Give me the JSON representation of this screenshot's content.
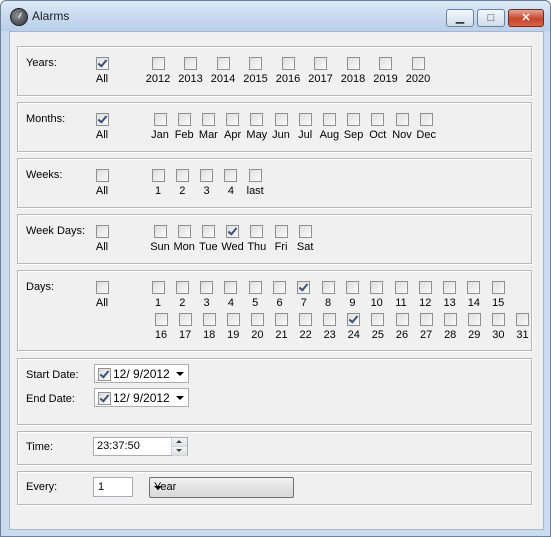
{
  "window": {
    "title": "Alarms",
    "minimize_label": "▁",
    "maximize_label": "□",
    "close_label": "✕"
  },
  "years": {
    "label": "Years:",
    "items": [
      {
        "label": "All",
        "checked": true
      },
      {
        "label": "2012",
        "checked": false
      },
      {
        "label": "2013",
        "checked": false
      },
      {
        "label": "2014",
        "checked": false
      },
      {
        "label": "2015",
        "checked": false
      },
      {
        "label": "2016",
        "checked": false
      },
      {
        "label": "2017",
        "checked": false
      },
      {
        "label": "2018",
        "checked": false
      },
      {
        "label": "2019",
        "checked": false
      },
      {
        "label": "2020",
        "checked": false
      }
    ]
  },
  "months": {
    "label": "Months:",
    "items": [
      {
        "label": "All",
        "checked": true
      },
      {
        "label": "Jan",
        "checked": false
      },
      {
        "label": "Feb",
        "checked": false
      },
      {
        "label": "Mar",
        "checked": false
      },
      {
        "label": "Apr",
        "checked": false
      },
      {
        "label": "May",
        "checked": false
      },
      {
        "label": "Jun",
        "checked": false
      },
      {
        "label": "Jul",
        "checked": false
      },
      {
        "label": "Aug",
        "checked": false
      },
      {
        "label": "Sep",
        "checked": false
      },
      {
        "label": "Oct",
        "checked": false
      },
      {
        "label": "Nov",
        "checked": false
      },
      {
        "label": "Dec",
        "checked": false
      }
    ]
  },
  "weeks": {
    "label": "Weeks:",
    "items": [
      {
        "label": "All",
        "checked": false
      },
      {
        "label": "1",
        "checked": false
      },
      {
        "label": "2",
        "checked": false
      },
      {
        "label": "3",
        "checked": false
      },
      {
        "label": "4",
        "checked": false
      },
      {
        "label": "last",
        "checked": false
      }
    ]
  },
  "weekdays": {
    "label": "Week Days:",
    "items": [
      {
        "label": "All",
        "checked": false
      },
      {
        "label": "Sun",
        "checked": false
      },
      {
        "label": "Mon",
        "checked": false
      },
      {
        "label": "Tue",
        "checked": false
      },
      {
        "label": "Wed",
        "checked": true
      },
      {
        "label": "Thu",
        "checked": false
      },
      {
        "label": "Fri",
        "checked": false
      },
      {
        "label": "Sat",
        "checked": false
      }
    ]
  },
  "days": {
    "label": "Days:",
    "all": {
      "label": "All",
      "checked": false
    },
    "row1": [
      {
        "label": "1",
        "checked": false
      },
      {
        "label": "2",
        "checked": false
      },
      {
        "label": "3",
        "checked": false
      },
      {
        "label": "4",
        "checked": false
      },
      {
        "label": "5",
        "checked": false
      },
      {
        "label": "6",
        "checked": false
      },
      {
        "label": "7",
        "checked": true
      },
      {
        "label": "8",
        "checked": false
      },
      {
        "label": "9",
        "checked": false
      },
      {
        "label": "10",
        "checked": false
      },
      {
        "label": "11",
        "checked": false
      },
      {
        "label": "12",
        "checked": false
      },
      {
        "label": "13",
        "checked": false
      },
      {
        "label": "14",
        "checked": false
      },
      {
        "label": "15",
        "checked": false
      }
    ],
    "row2": [
      {
        "label": "16",
        "checked": false
      },
      {
        "label": "17",
        "checked": false
      },
      {
        "label": "18",
        "checked": false
      },
      {
        "label": "19",
        "checked": false
      },
      {
        "label": "20",
        "checked": false
      },
      {
        "label": "21",
        "checked": false
      },
      {
        "label": "22",
        "checked": false
      },
      {
        "label": "23",
        "checked": false
      },
      {
        "label": "24",
        "checked": true
      },
      {
        "label": "25",
        "checked": false
      },
      {
        "label": "26",
        "checked": false
      },
      {
        "label": "27",
        "checked": false
      },
      {
        "label": "28",
        "checked": false
      },
      {
        "label": "29",
        "checked": false
      },
      {
        "label": "30",
        "checked": false
      },
      {
        "label": "31",
        "checked": false
      }
    ]
  },
  "dates": {
    "start_label": "Start Date:",
    "start_value": "12/  9/2012",
    "start_checked": true,
    "end_label": "End Date:",
    "end_value": "12/  9/2012",
    "end_checked": true
  },
  "time": {
    "label": "Time:",
    "value": "23:37:50"
  },
  "every": {
    "label": "Every:",
    "count": "1",
    "unit": "Year"
  }
}
